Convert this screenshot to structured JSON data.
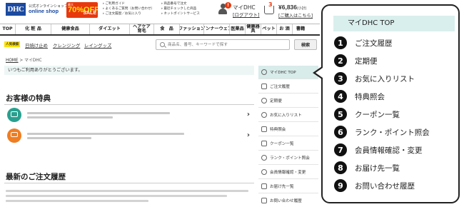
{
  "header": {
    "logo": "DHC",
    "shop_sub": "公式オンラインショップ",
    "shop_name": "online shop",
    "sale": {
      "line1": "最大",
      "percent": "70%OFF",
      "label": "SALE"
    },
    "links_col1": [
      "ご利用ガイド",
      "よくあるご質問（お問い合わせ）",
      "ご注文履歴／お気に入り"
    ],
    "links_col2": [
      "商品番号で注文",
      "最近チェックした商品",
      "ネットポイントサービス"
    ],
    "mydhc": {
      "badge": "!",
      "title": "マイDHC",
      "login": "[ログアウト]"
    },
    "cart": {
      "count": "3",
      "price": "¥6,836",
      "tax": "(小計)",
      "link": "[ご購入はこちら]"
    }
  },
  "nav": {
    "items": [
      "TOP",
      "化 粧 品",
      "健康食品",
      "ダイエット",
      "ヘアケア\n育毛",
      "食　品",
      "ファッション",
      "インナーウェア",
      "医薬品",
      "健康器\n具",
      "ペット",
      "お 酒",
      "書籍"
    ]
  },
  "subnav": {
    "tag": "人気検索",
    "links": [
      "日焼け止め",
      "クレンジング",
      "レイングッズ"
    ]
  },
  "search": {
    "placeholder": "商品名、番号、キーワードで探す",
    "button": "検索"
  },
  "breadcrumb": {
    "home": "HOME",
    "sep": " > ",
    "current": "マイDHC"
  },
  "thanks": "いつもご利用ありがとうございます。",
  "benefits": {
    "title": "お客様の特典",
    "perks": [
      {
        "icon": "card-icon",
        "label": ""
      },
      {
        "icon": "gift-icon",
        "label": ""
      }
    ]
  },
  "orders": {
    "title": "最新のご注文履歴"
  },
  "sidebar": {
    "items": [
      {
        "label": "マイDHC TOP",
        "icon": "person-icon",
        "active": true
      },
      {
        "label": "ご注文履歴",
        "icon": "list-icon"
      },
      {
        "label": "定期便",
        "icon": "cycle-icon"
      },
      {
        "label": "お気に入りリスト",
        "icon": "heart-icon"
      },
      {
        "label": "特典照会",
        "icon": "gift-icon"
      },
      {
        "label": "クーポン一覧",
        "icon": "coupon-icon"
      },
      {
        "label": "ランク・ポイント照会",
        "icon": "point-icon"
      },
      {
        "label": "会員情報確認・変更",
        "icon": "gear-icon"
      },
      {
        "label": "お届け先一覧",
        "icon": "truck-icon"
      },
      {
        "label": "お問い合わせ履歴",
        "icon": "mail-icon"
      }
    ]
  },
  "callout": {
    "title": "マイDHC TOP",
    "items": [
      {
        "num": "1",
        "label": "ご注文履歴"
      },
      {
        "num": "2",
        "label": "定期便"
      },
      {
        "num": "3",
        "label": "お気に入りリスト"
      },
      {
        "num": "4",
        "label": "特典照会"
      },
      {
        "num": "5",
        "label": "クーポン一覧"
      },
      {
        "num": "6",
        "label": "ランク・ポイント照会"
      },
      {
        "num": "7",
        "label": "会員情報確認・変更"
      },
      {
        "num": "8",
        "label": "お届け先一覧"
      },
      {
        "num": "9",
        "label": "お問い合わせ履歴"
      }
    ]
  },
  "colors": {
    "brand": "#1b4aa0",
    "sale": "#e8380d",
    "accent_teal": "#29a08f",
    "highlight": "#d9efed"
  }
}
